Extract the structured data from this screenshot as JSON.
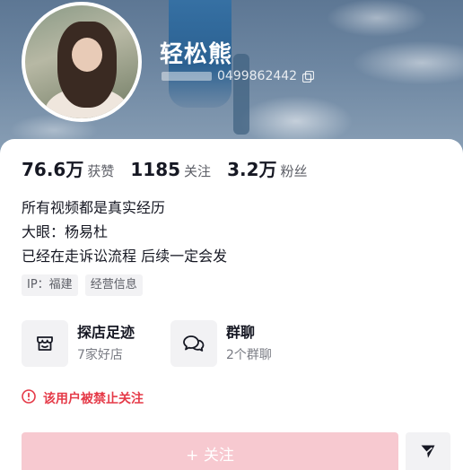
{
  "profile": {
    "nickname": "轻松熊",
    "account_id": "0499862442"
  },
  "stats": [
    {
      "value": "76.6万",
      "label": "获赞"
    },
    {
      "value": "1185",
      "label": "关注"
    },
    {
      "value": "3.2万",
      "label": "粉丝"
    }
  ],
  "bio": {
    "line1": "所有视频都是真实经历",
    "line2": "大眼：杨易杜",
    "line3": "已经在走诉讼流程 后续一定会发"
  },
  "tags": {
    "ip": "IP：福建",
    "business": "经营信息"
  },
  "services": {
    "store_visits": {
      "title": "探店足迹",
      "subtitle": "7家好店"
    },
    "group_chat": {
      "title": "群聊",
      "subtitle": "2个群聊"
    }
  },
  "notice": {
    "banned_text": "该用户被禁止关注"
  },
  "actions": {
    "follow_label": "+ 关注"
  },
  "colors": {
    "follow_button_disabled": "#f7c9d0",
    "warning_red": "#e53a48"
  }
}
